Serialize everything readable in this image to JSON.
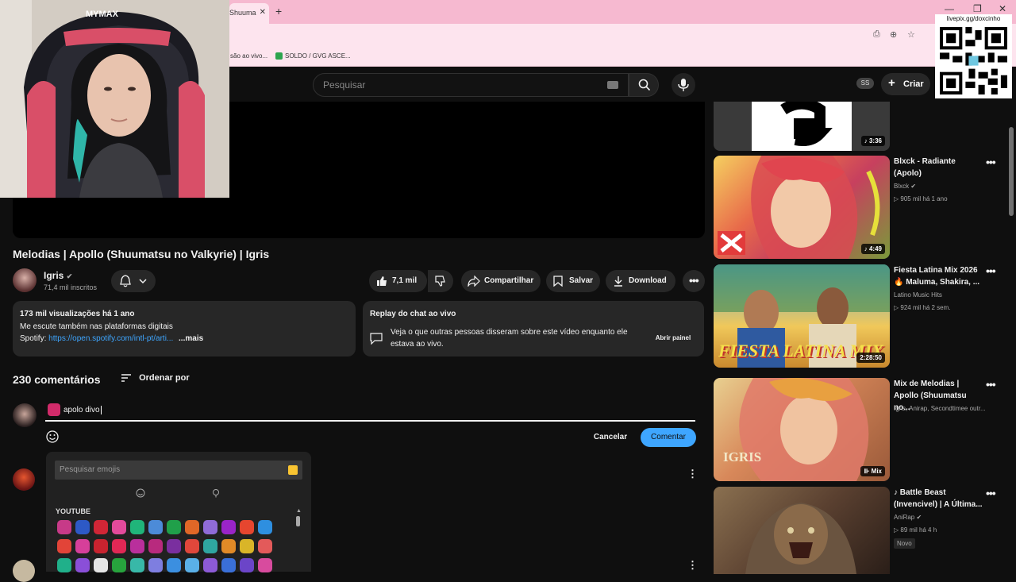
{
  "browser": {
    "tab_title": "Shuuma",
    "bookmarks": [
      "são ao vivo...",
      "SOLDO / GVG ASCE..."
    ]
  },
  "overlay": {
    "webcam_brand": "MYMAX",
    "qr_label": "livepix.gg/doxcinho"
  },
  "header": {
    "search_placeholder": "Pesquisar",
    "badge": "SS",
    "create_label": "Criar"
  },
  "video": {
    "title": "Melodias | Apollo (Shuumatsu no Valkyrie) | Igris",
    "channel": "Igris",
    "subscribers": "71,4 mil inscritos",
    "likes": "7,1 mil",
    "share": "Compartilhar",
    "save": "Salvar",
    "download": "Download"
  },
  "description": {
    "stats": "173 mil visualizações  há 1 ano",
    "line1": "Me escute também nas plataformas digitais",
    "spotify_label": "Spotify:",
    "spotify_url": "https://open.spotify.com/intl-pt/arti...",
    "more": "...mais"
  },
  "chat_replay": {
    "title": "Replay do chat ao vivo",
    "text": "Veja o que outras pessoas disseram sobre este vídeo enquanto ele estava ao vivo.",
    "button": "Abrir painel"
  },
  "comments": {
    "count": "230 comentários",
    "sort": "Ordenar por",
    "draft": "apolo divo",
    "cancel": "Cancelar",
    "submit": "Comentar"
  },
  "emoji_picker": {
    "placeholder": "Pesquisar emojis",
    "category": "YOUTUBE"
  },
  "recommendations": [
    {
      "title": "",
      "channel": "",
      "meta": "",
      "duration": "3:36"
    },
    {
      "title": "Blxck - Radiante (Apolo)",
      "channel": "Blxck",
      "meta": "905 mil  há 1 ano",
      "duration": "4:49"
    },
    {
      "title": "Fiesta Latina Mix 2026 🔥 Maluma, Shakira, ...",
      "channel": "Latino Music Hits",
      "meta": "924 mil  há 2 sem.",
      "duration": "2:28:50",
      "thumb_text": "FIESTA LATINA MIX"
    },
    {
      "title": "Mix de Melodias | Apollo (Shuumatsu no...",
      "channel": "Igris, Anirap, Secondtimee outr...",
      "meta": "",
      "duration": "Mix",
      "thumb_text": "IGRIS"
    },
    {
      "title": "♪ Battle Beast (Invencivel) | A Última...",
      "channel": "AniRap",
      "meta": "89 mil  há 4 h",
      "badge": "Novo"
    }
  ]
}
